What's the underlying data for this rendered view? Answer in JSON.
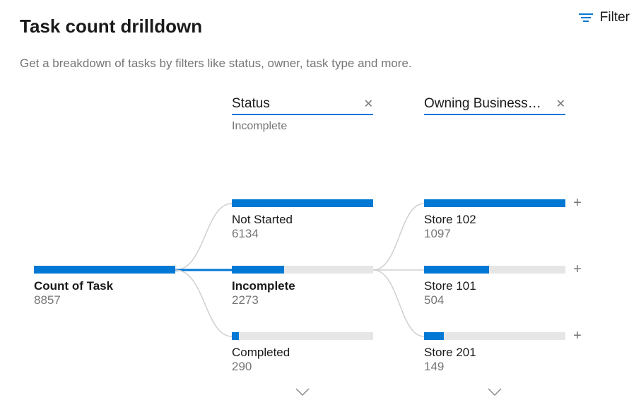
{
  "header": {
    "title": "Task count drilldown",
    "subtitle": "Get a breakdown of tasks by filters like status, owner, task type and more."
  },
  "filter": {
    "label": "Filter"
  },
  "columns": {
    "status": {
      "label": "Status",
      "sublabel": "Incomplete"
    },
    "owning": {
      "label": "Owning Business…"
    }
  },
  "root": {
    "label": "Count of Task",
    "value": "8857"
  },
  "status_nodes": {
    "not_started": {
      "label": "Not Started",
      "value": "6134"
    },
    "incomplete": {
      "label": "Incomplete",
      "value": "2273"
    },
    "completed": {
      "label": "Completed",
      "value": "290"
    }
  },
  "owning_nodes": {
    "store102": {
      "label": "Store 102",
      "value": "1097"
    },
    "store101": {
      "label": "Store 101",
      "value": "504"
    },
    "store201": {
      "label": "Store 201",
      "value": "149"
    }
  },
  "chart_data": {
    "type": "bar",
    "title": "Task count drilldown",
    "root": {
      "label": "Count of Task",
      "value": 8857
    },
    "levels": [
      {
        "name": "Status",
        "selected": "Incomplete",
        "items": [
          {
            "label": "Not Started",
            "value": 6134
          },
          {
            "label": "Incomplete",
            "value": 2273
          },
          {
            "label": "Completed",
            "value": 290
          }
        ],
        "max": 6134
      },
      {
        "name": "Owning Business Unit",
        "items": [
          {
            "label": "Store 102",
            "value": 1097
          },
          {
            "label": "Store 101",
            "value": 504
          },
          {
            "label": "Store 201",
            "value": 149
          }
        ],
        "max": 1097
      }
    ]
  }
}
